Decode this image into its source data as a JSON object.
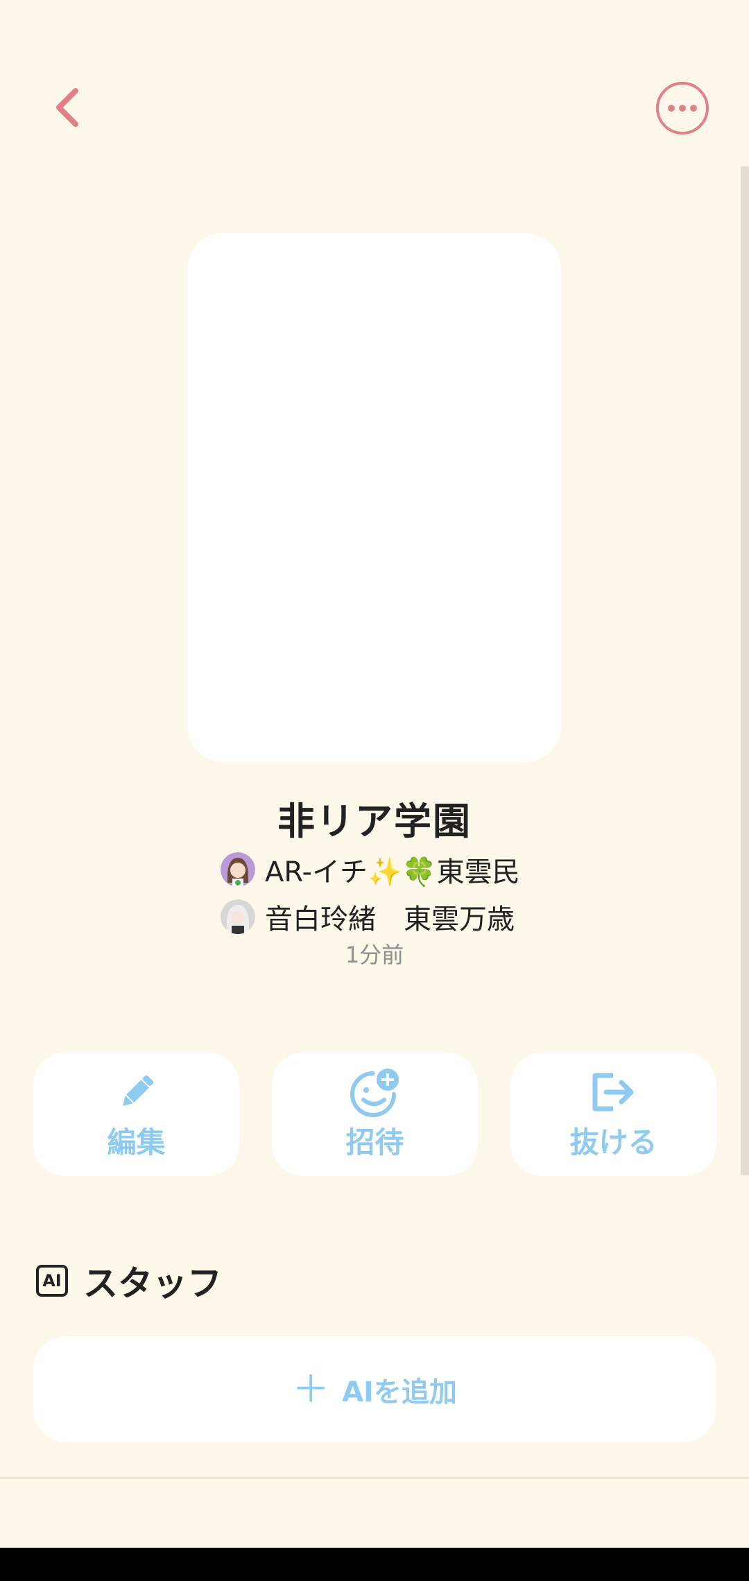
{
  "header": {
    "back_icon": "chevron-left-icon",
    "more_icon": "more-horizontal-icon",
    "accent_color": "#e37f86"
  },
  "group": {
    "title": "非リア学園",
    "members": [
      {
        "name": "AR-イチ✨🍀東雲民",
        "avatar": "anime-girl-avatar"
      },
      {
        "name": "音白玲緒　東雲万歳",
        "avatar": "anime-girl-avatar"
      }
    ],
    "updated": "1分前"
  },
  "actions": {
    "edit": "編集",
    "invite": "招待",
    "leave": "抜ける",
    "color": "#8fcaf0"
  },
  "staff": {
    "badge": "AI",
    "title": "スタッフ",
    "add_label": "AIを追加",
    "add_icon": "plus-icon"
  }
}
